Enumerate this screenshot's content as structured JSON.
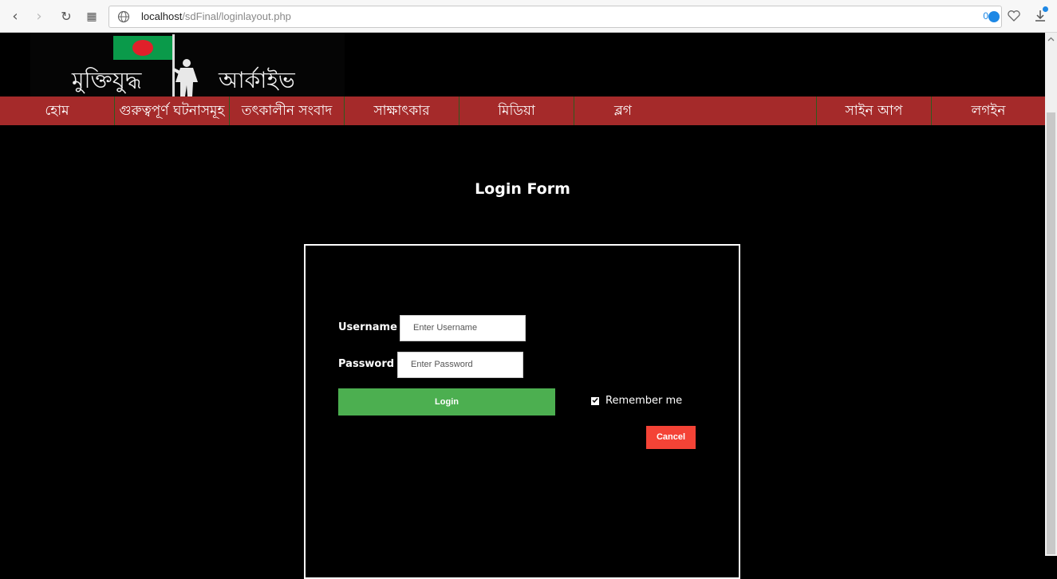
{
  "browser": {
    "url_host": "localhost",
    "url_path": "/sdFinal/loginlayout.php",
    "counter": "0"
  },
  "site": {
    "logo_text_left": "মুক্তিযুদ্ধ",
    "logo_text_right": "আর্কাইভ",
    "logo_colors": {
      "flag_green": "#0a9a4a",
      "flag_red": "#e0202a"
    }
  },
  "menu": {
    "background": "#a52a2a",
    "items": [
      {
        "label": "হোম"
      },
      {
        "label": "গুরুত্বপূর্ণ ঘটনাসমূহ"
      },
      {
        "label": "তৎকালীন সংবাদ"
      },
      {
        "label": "সাক্ষাৎকার"
      },
      {
        "label": "মিডিয়া"
      },
      {
        "label": "ব্লগ"
      },
      {
        "label": "সাইন আপ"
      },
      {
        "label": "লগইন"
      }
    ]
  },
  "login": {
    "title": "Login Form",
    "username_label": "Username",
    "username_placeholder": "Enter Username",
    "password_label": "Password",
    "password_placeholder": "Enter Password",
    "login_button": "Login",
    "remember_label": "Remember me",
    "remember_checked": true,
    "cancel_button": "Cancel",
    "colors": {
      "login": "#4caf50",
      "cancel": "#f44336"
    }
  }
}
